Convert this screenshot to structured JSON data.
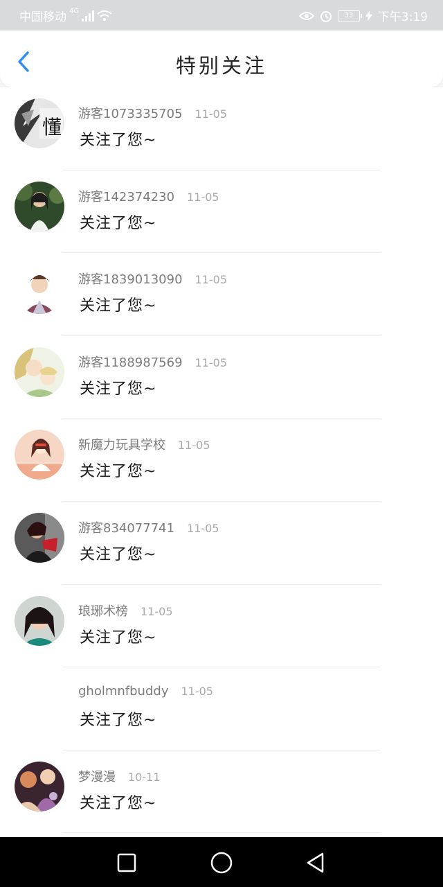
{
  "status_bar": {
    "carrier": "中国移动",
    "network": "4G",
    "battery": "33",
    "time": "下午3:19"
  },
  "header": {
    "title": "特别关注",
    "back_icon": "chevron-left-icon"
  },
  "colors": {
    "accent": "#2b8ef0",
    "status_bar_bg": "#d9dadc",
    "nav_bar_bg": "#000000"
  },
  "list": {
    "items": [
      {
        "name": "游客1073335705",
        "date": "11-05",
        "message": "关注了您~",
        "avatar_char": "懂"
      },
      {
        "name": "游客142374230",
        "date": "11-05",
        "message": "关注了您~"
      },
      {
        "name": "游客1839013090",
        "date": "11-05",
        "message": "关注了您~"
      },
      {
        "name": "游客1188987569",
        "date": "11-05",
        "message": "关注了您~"
      },
      {
        "name": "新魔力玩具学校",
        "date": "11-05",
        "message": "关注了您~"
      },
      {
        "name": "游客834077741",
        "date": "11-05",
        "message": "关注了您~"
      },
      {
        "name": "琅琊术榜",
        "date": "11-05",
        "message": "关注了您~"
      },
      {
        "name": "gholmnfbuddy",
        "date": "11-05",
        "message": "关注了您~"
      },
      {
        "name": "梦漫漫",
        "date": "10-11",
        "message": "关注了您~"
      }
    ]
  },
  "nav_bar": {
    "icons": [
      "square-icon",
      "circle-home-icon",
      "triangle-back-icon"
    ]
  }
}
